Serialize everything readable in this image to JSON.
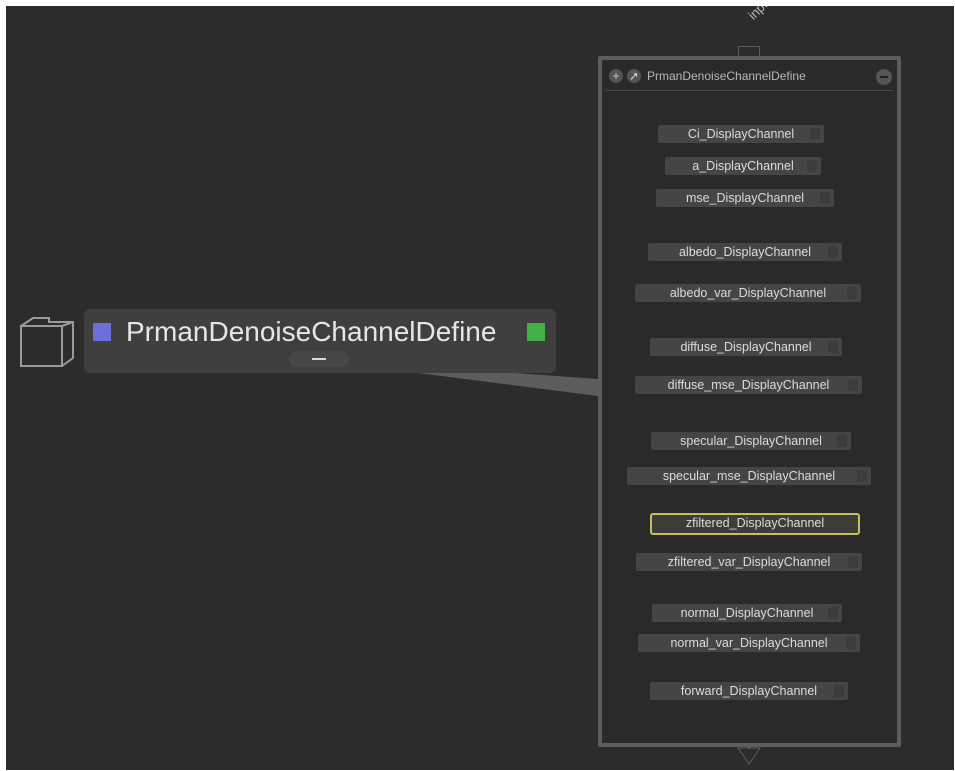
{
  "canvas": {
    "input_label": "input",
    "background_color": "#2c2c2c"
  },
  "collapsed_group": {
    "title": "PrmanDenoiseChannelDefine",
    "left_swatch_color": "#6e6ed8",
    "right_swatch_color": "#44b04a",
    "icon": "folder-icon"
  },
  "expanded_group": {
    "title": "PrmanDenoiseChannelDefine",
    "header_icons": [
      "add-icon",
      "pin-icon",
      "minimize-icon"
    ],
    "nodes": [
      {
        "label": "Ci_DisplayChannel",
        "selected": false
      },
      {
        "label": "a_DisplayChannel",
        "selected": false
      },
      {
        "label": "mse_DisplayChannel",
        "selected": false
      },
      {
        "label": "albedo_DisplayChannel",
        "selected": false
      },
      {
        "label": "albedo_var_DisplayChannel",
        "selected": false
      },
      {
        "label": "diffuse_DisplayChannel",
        "selected": false
      },
      {
        "label": "diffuse_mse_DisplayChannel",
        "selected": false
      },
      {
        "label": "specular_DisplayChannel",
        "selected": false
      },
      {
        "label": "specular_mse_DisplayChannel",
        "selected": false
      },
      {
        "label": "zfiltered_DisplayChannel",
        "selected": true
      },
      {
        "label": "zfiltered_var_DisplayChannel",
        "selected": false
      },
      {
        "label": "normal_DisplayChannel",
        "selected": false
      },
      {
        "label": "normal_var_DisplayChannel",
        "selected": false
      },
      {
        "label": "forward_DisplayChannel",
        "selected": false
      }
    ],
    "selected_outline_color": "#c5c05a"
  }
}
